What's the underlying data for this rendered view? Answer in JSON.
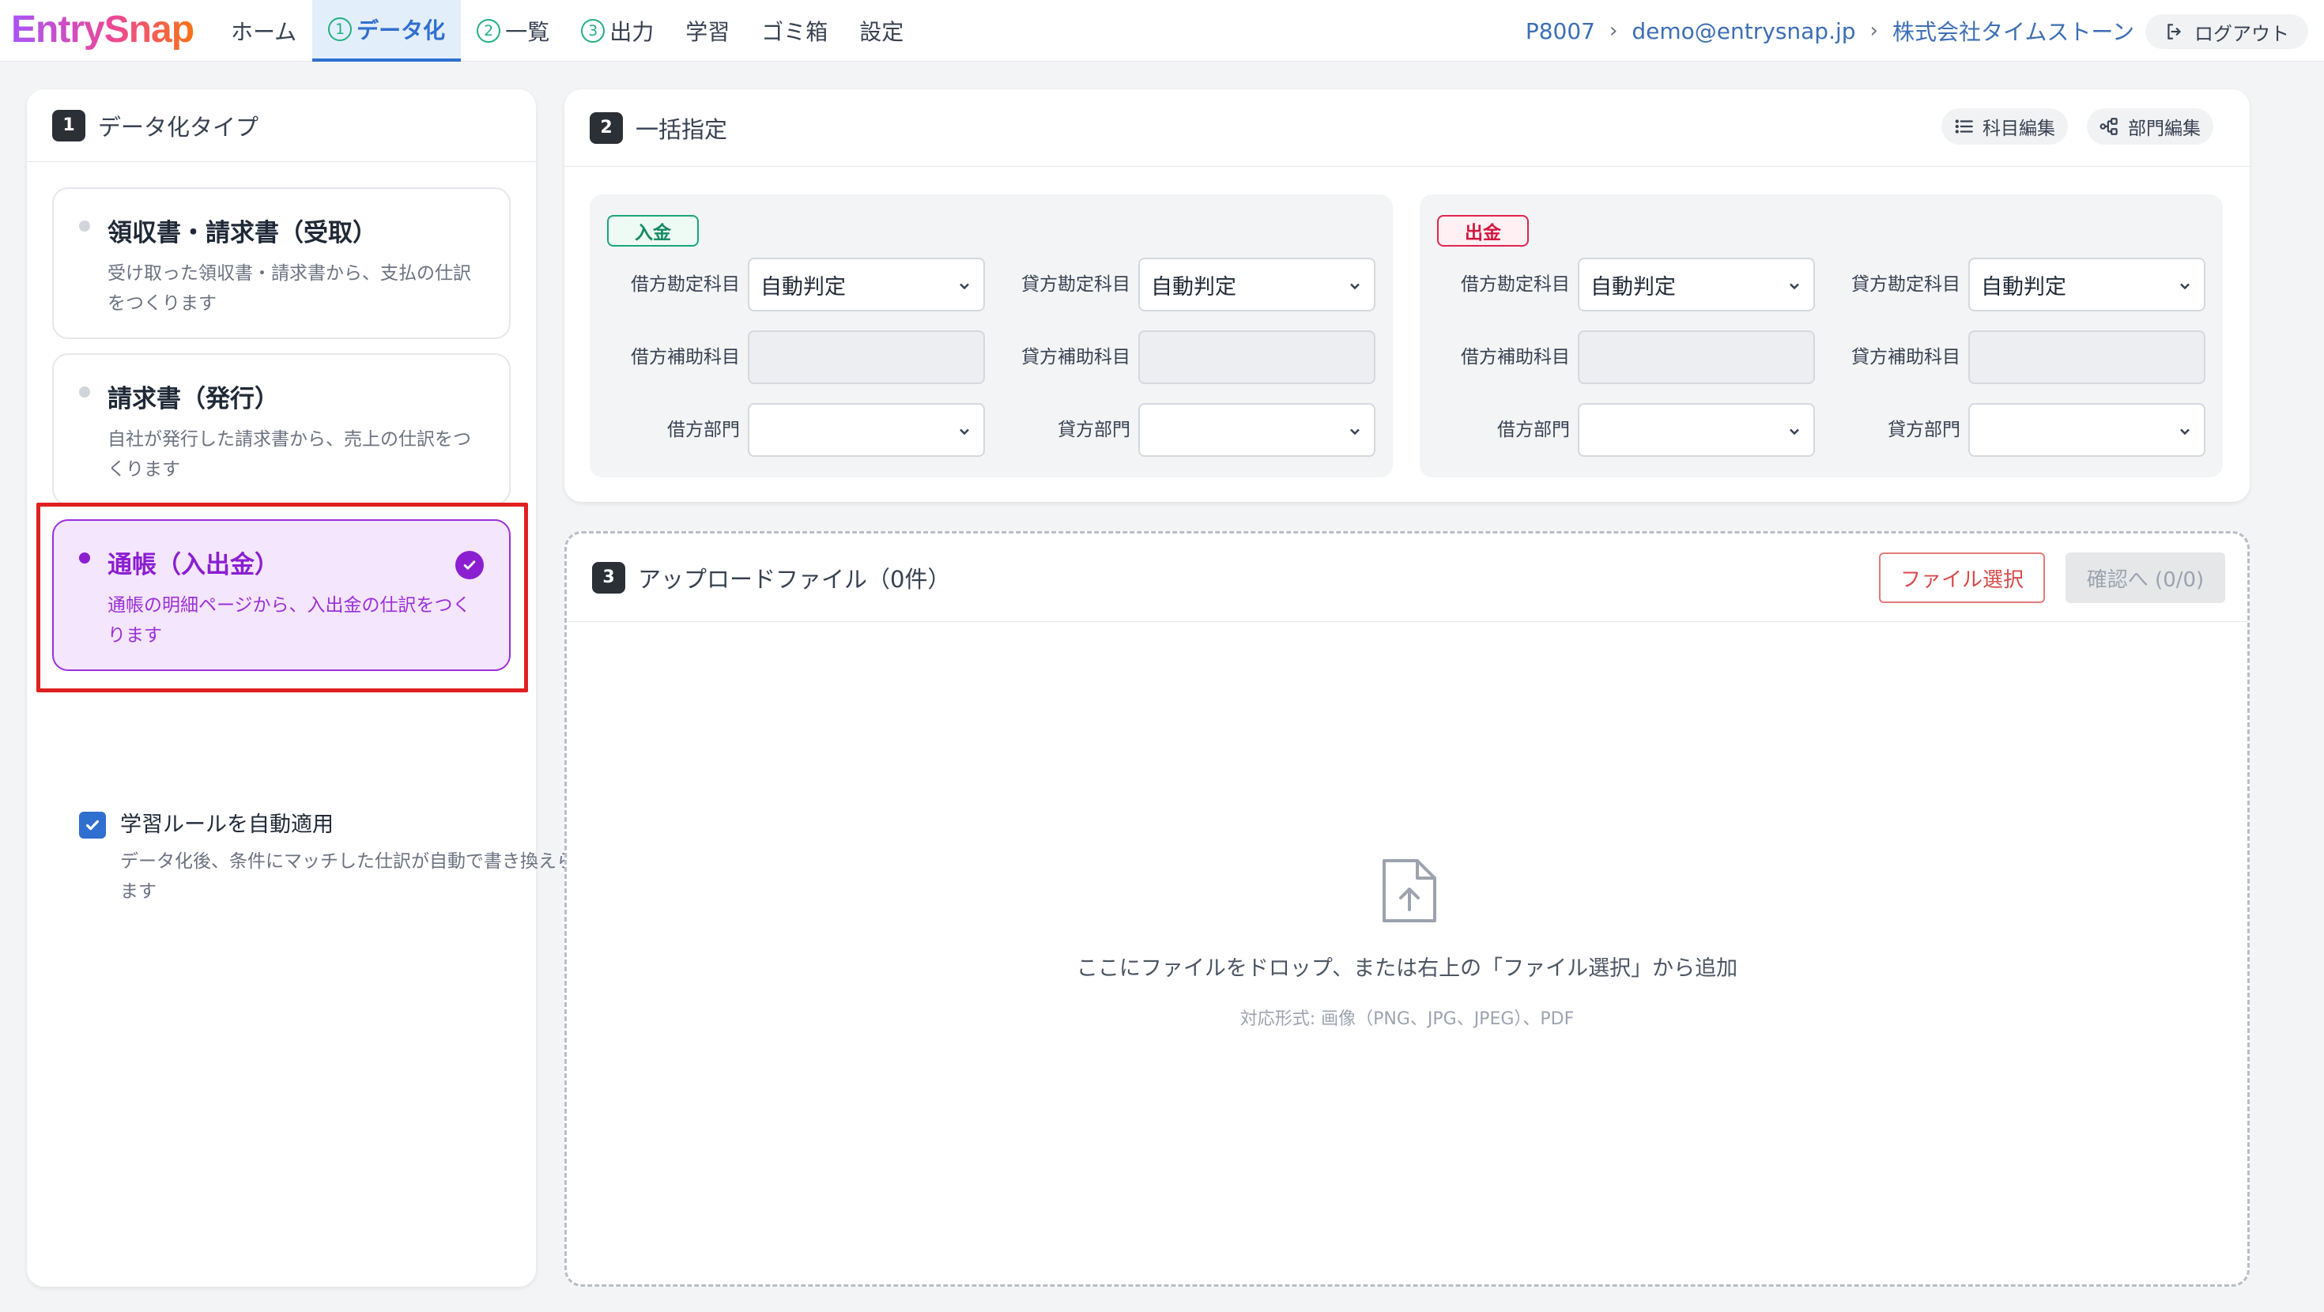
{
  "app": {
    "logo": "EntrySnap",
    "logo_gradient": [
      "#a855f7",
      "#ec4899",
      "#f97316"
    ]
  },
  "nav": {
    "home": "ホーム",
    "step1_num": "1",
    "step1": "データ化",
    "step2_num": "2",
    "step2": "一覧",
    "step3_num": "3",
    "step3": "出力",
    "learn": "学習",
    "trash": "ゴミ箱",
    "settings": "設定"
  },
  "account": {
    "code": "P8007",
    "email": "demo@entrysnap.jp",
    "company": "株式会社タイムストーン",
    "logout": "ログアウト"
  },
  "type_section": {
    "num": "1",
    "title": "データ化タイプ",
    "options": [
      {
        "title": "領収書・請求書（受取）",
        "desc": "受け取った領収書・請求書から、支払の仕訳をつくります",
        "selected": false
      },
      {
        "title": "請求書（発行）",
        "desc": "自社が発行した請求書から、売上の仕訳をつくります",
        "selected": false
      },
      {
        "title": "通帳（入出金）",
        "desc": "通帳の明細ページから、入出金の仕訳をつくります",
        "selected": true
      }
    ],
    "auto_rule": {
      "label": "学習ルールを自動適用",
      "desc": "データ化後、条件にマッチした仕訳が自動で書き換えられます",
      "checked": true
    }
  },
  "batch_section": {
    "num": "2",
    "title": "一括指定",
    "edit_accounts": "科目編集",
    "edit_departments": "部門編集",
    "deposit": {
      "tag": "入金",
      "debit_account_label": "借方勘定科目",
      "debit_account_value": "自動判定",
      "credit_account_label": "貸方勘定科目",
      "credit_account_value": "自動判定",
      "debit_sub_label": "借方補助科目",
      "credit_sub_label": "貸方補助科目",
      "debit_dept_label": "借方部門",
      "credit_dept_label": "貸方部門"
    },
    "withdrawal": {
      "tag": "出金",
      "debit_account_label": "借方勘定科目",
      "debit_account_value": "自動判定",
      "credit_account_label": "貸方勘定科目",
      "credit_account_value": "自動判定",
      "debit_sub_label": "借方補助科目",
      "credit_sub_label": "貸方補助科目",
      "debit_dept_label": "借方部門",
      "credit_dept_label": "貸方部門"
    }
  },
  "upload_section": {
    "num": "3",
    "title": "アップロードファイル（0件）",
    "select_file": "ファイル選択",
    "confirm": "確認へ (0/0)",
    "drop_text": "ここにファイルをドロップ、または右上の「ファイル選択」から追加",
    "formats": "対応形式: 画像（PNG、JPG、JPEG）、PDF"
  },
  "colors": {
    "accent_blue": "#2f6fcf",
    "selected_purple": "#8b1ed1",
    "deposit_green": "#19a67a",
    "withdrawal_red": "#e0264e",
    "highlight_red": "#e02020"
  }
}
